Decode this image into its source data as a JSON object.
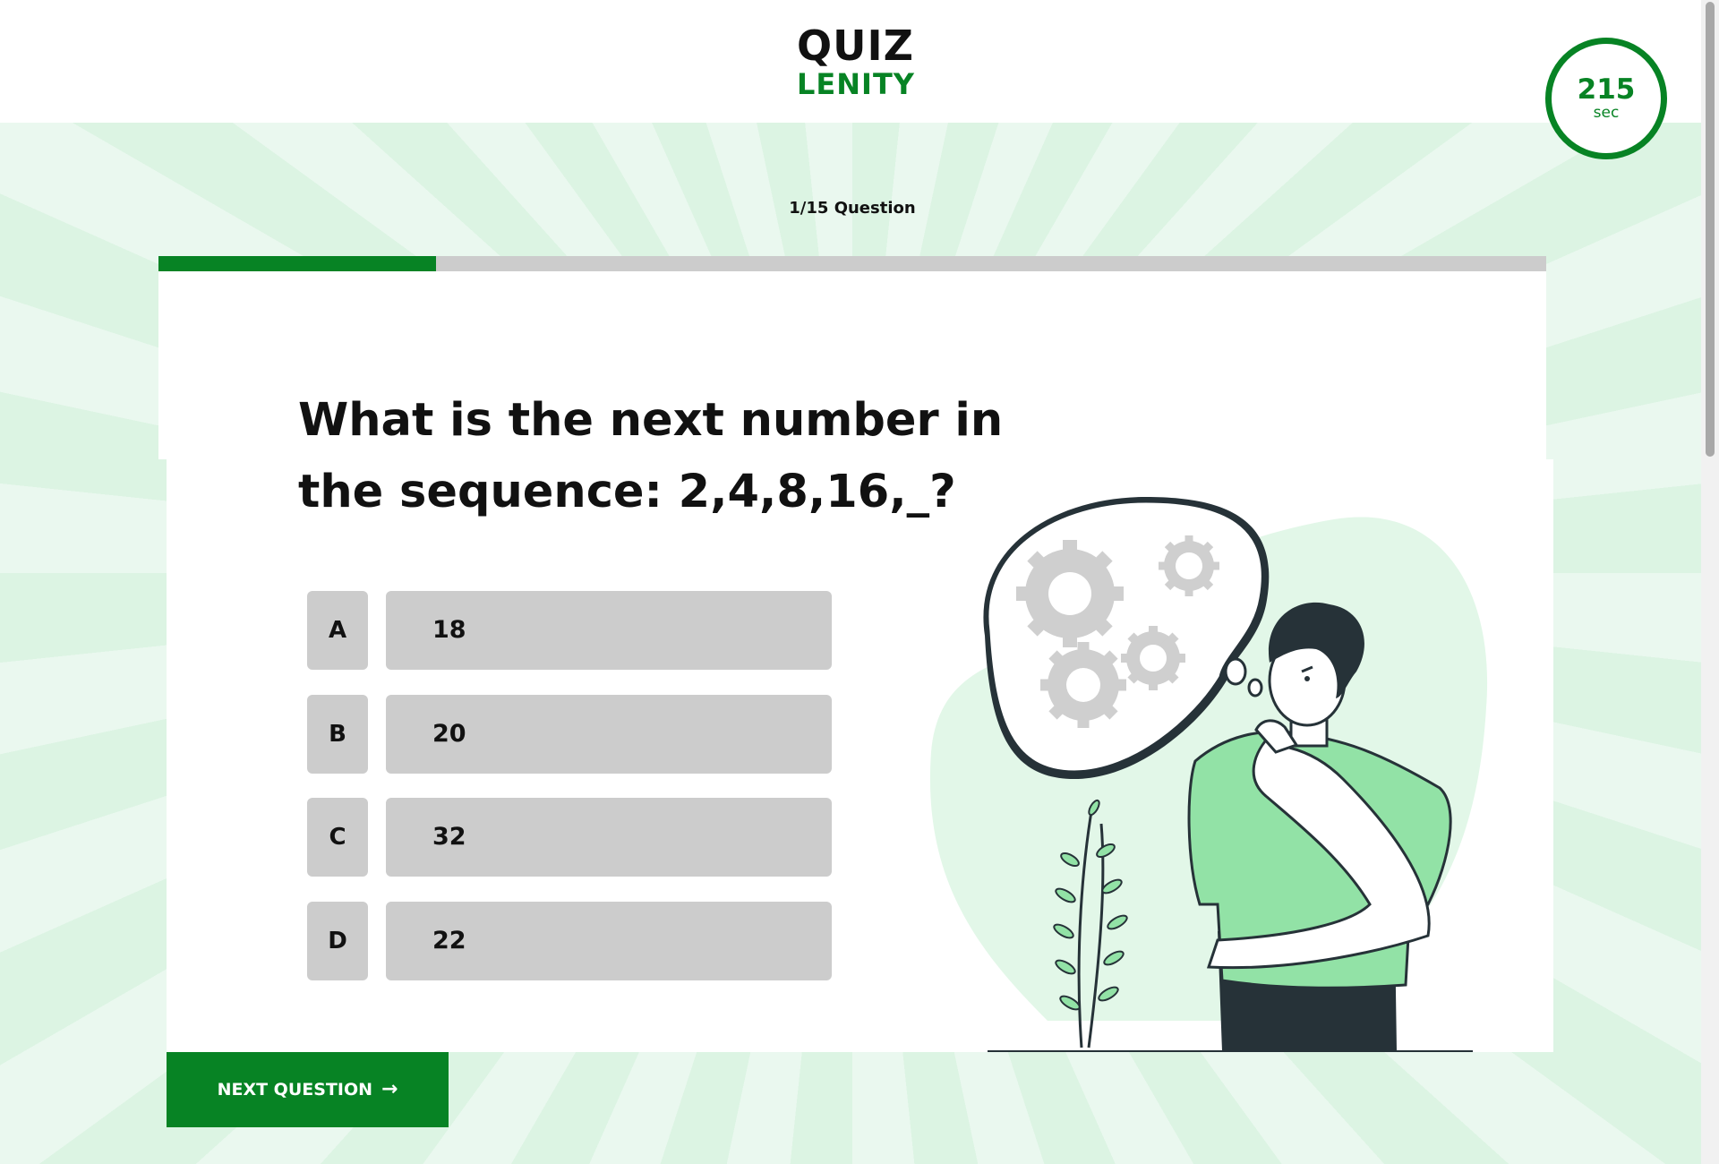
{
  "header": {
    "logo_top": "QUIZ",
    "logo_bottom": "LENITY",
    "timer_value": "215",
    "timer_unit": "sec"
  },
  "progress": {
    "label": "1/15 Question",
    "fraction": 0.2
  },
  "question": {
    "text": "What is the next number in the sequence: 2,4,8,16,_?"
  },
  "options": [
    {
      "letter": "A",
      "text": "18"
    },
    {
      "letter": "B",
      "text": "20"
    },
    {
      "letter": "C",
      "text": "32"
    },
    {
      "letter": "D",
      "text": "22"
    }
  ],
  "next_button": {
    "label": "NEXT QUESTION",
    "arrow": "→"
  },
  "colors": {
    "brand_green": "#078324",
    "option_gray": "#cccccc",
    "shirt_green": "#92e2a6",
    "background_light": "#dcf4e3"
  },
  "illustration": {
    "icons": [
      "thinking-man",
      "thought-bubble",
      "gear",
      "plant"
    ]
  }
}
